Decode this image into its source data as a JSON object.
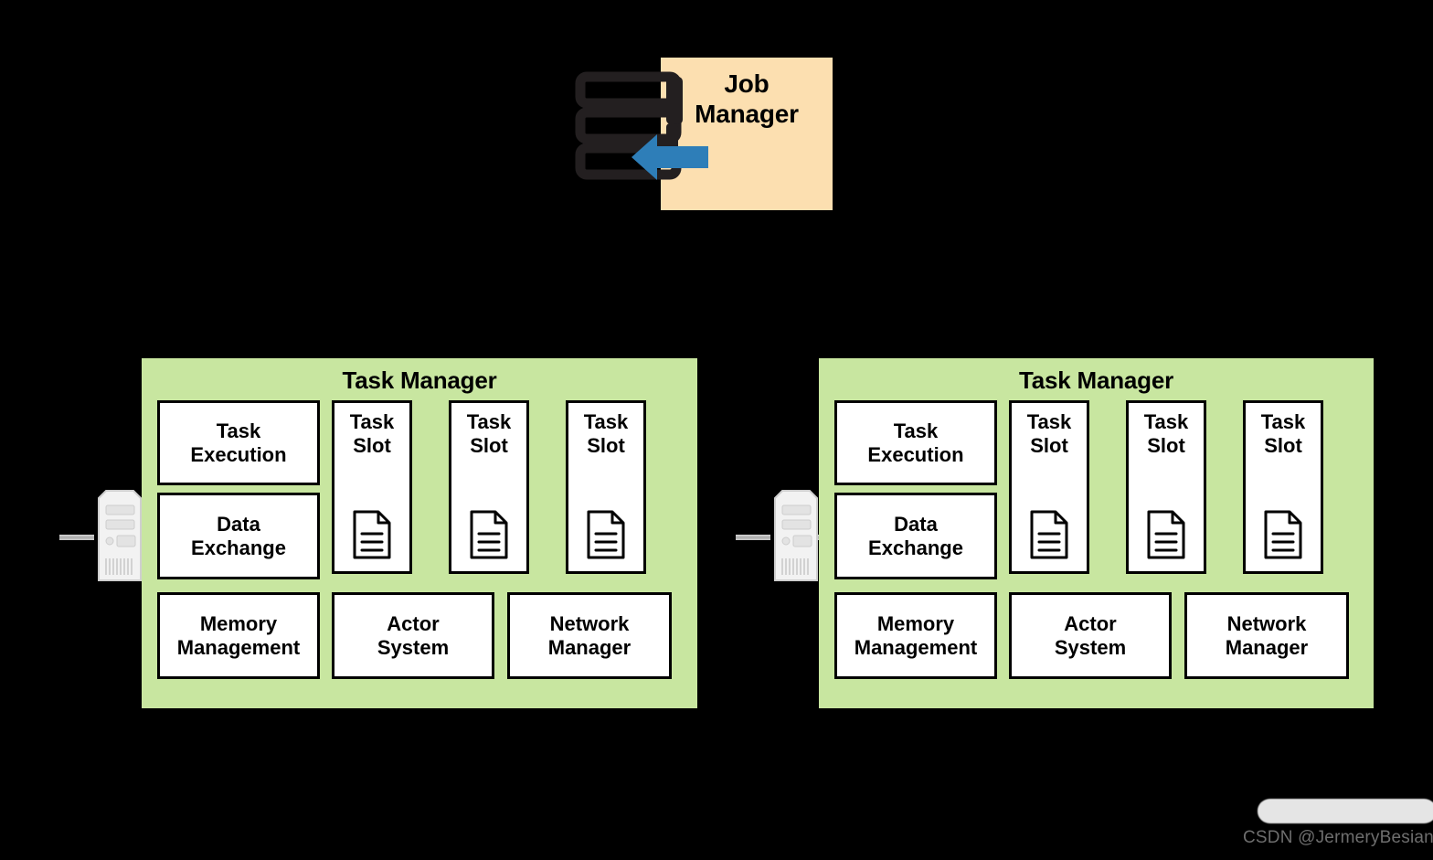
{
  "job_manager": {
    "title": "Job\nManager",
    "title_line1": "Job",
    "title_line2": "Manager",
    "box_color": "#FCDFB0",
    "icon": "server-stack-icon",
    "arrow_icon": "arrow-left-icon",
    "arrow_color": "#2E7EB8"
  },
  "task_managers": [
    {
      "title": "Task Manager",
      "panel_color": "#C8E6A0",
      "server_icon": "server-tower-icon",
      "components": [
        {
          "label": "Task\nExecution",
          "name": "task-execution"
        },
        {
          "label": "Data\nExchange",
          "name": "data-exchange"
        },
        {
          "label": "Memory\nManagement",
          "name": "memory-management"
        },
        {
          "label": "Actor\nSystem",
          "name": "actor-system"
        },
        {
          "label": "Network\nManager",
          "name": "network-manager"
        }
      ],
      "slots": [
        {
          "label": "Task\nSlot",
          "icon": "document-icon"
        },
        {
          "label": "Task\nSlot",
          "icon": "document-icon"
        },
        {
          "label": "Task\nSlot",
          "icon": "document-icon"
        }
      ]
    },
    {
      "title": "Task Manager",
      "panel_color": "#C8E6A0",
      "server_icon": "server-tower-icon",
      "components": [
        {
          "label": "Task\nExecution",
          "name": "task-execution"
        },
        {
          "label": "Data\nExchange",
          "name": "data-exchange"
        },
        {
          "label": "Memory\nManagement",
          "name": "memory-management"
        },
        {
          "label": "Actor\nSystem",
          "name": "actor-system"
        },
        {
          "label": "Network\nManager",
          "name": "network-manager"
        }
      ],
      "slots": [
        {
          "label": "Task\nSlot",
          "icon": "document-icon"
        },
        {
          "label": "Task\nSlot",
          "icon": "document-icon"
        },
        {
          "label": "Task\nSlot",
          "icon": "document-icon"
        }
      ]
    }
  ],
  "watermark": {
    "text": "CSDN @JermeryBesian"
  },
  "background_color": "#000000"
}
